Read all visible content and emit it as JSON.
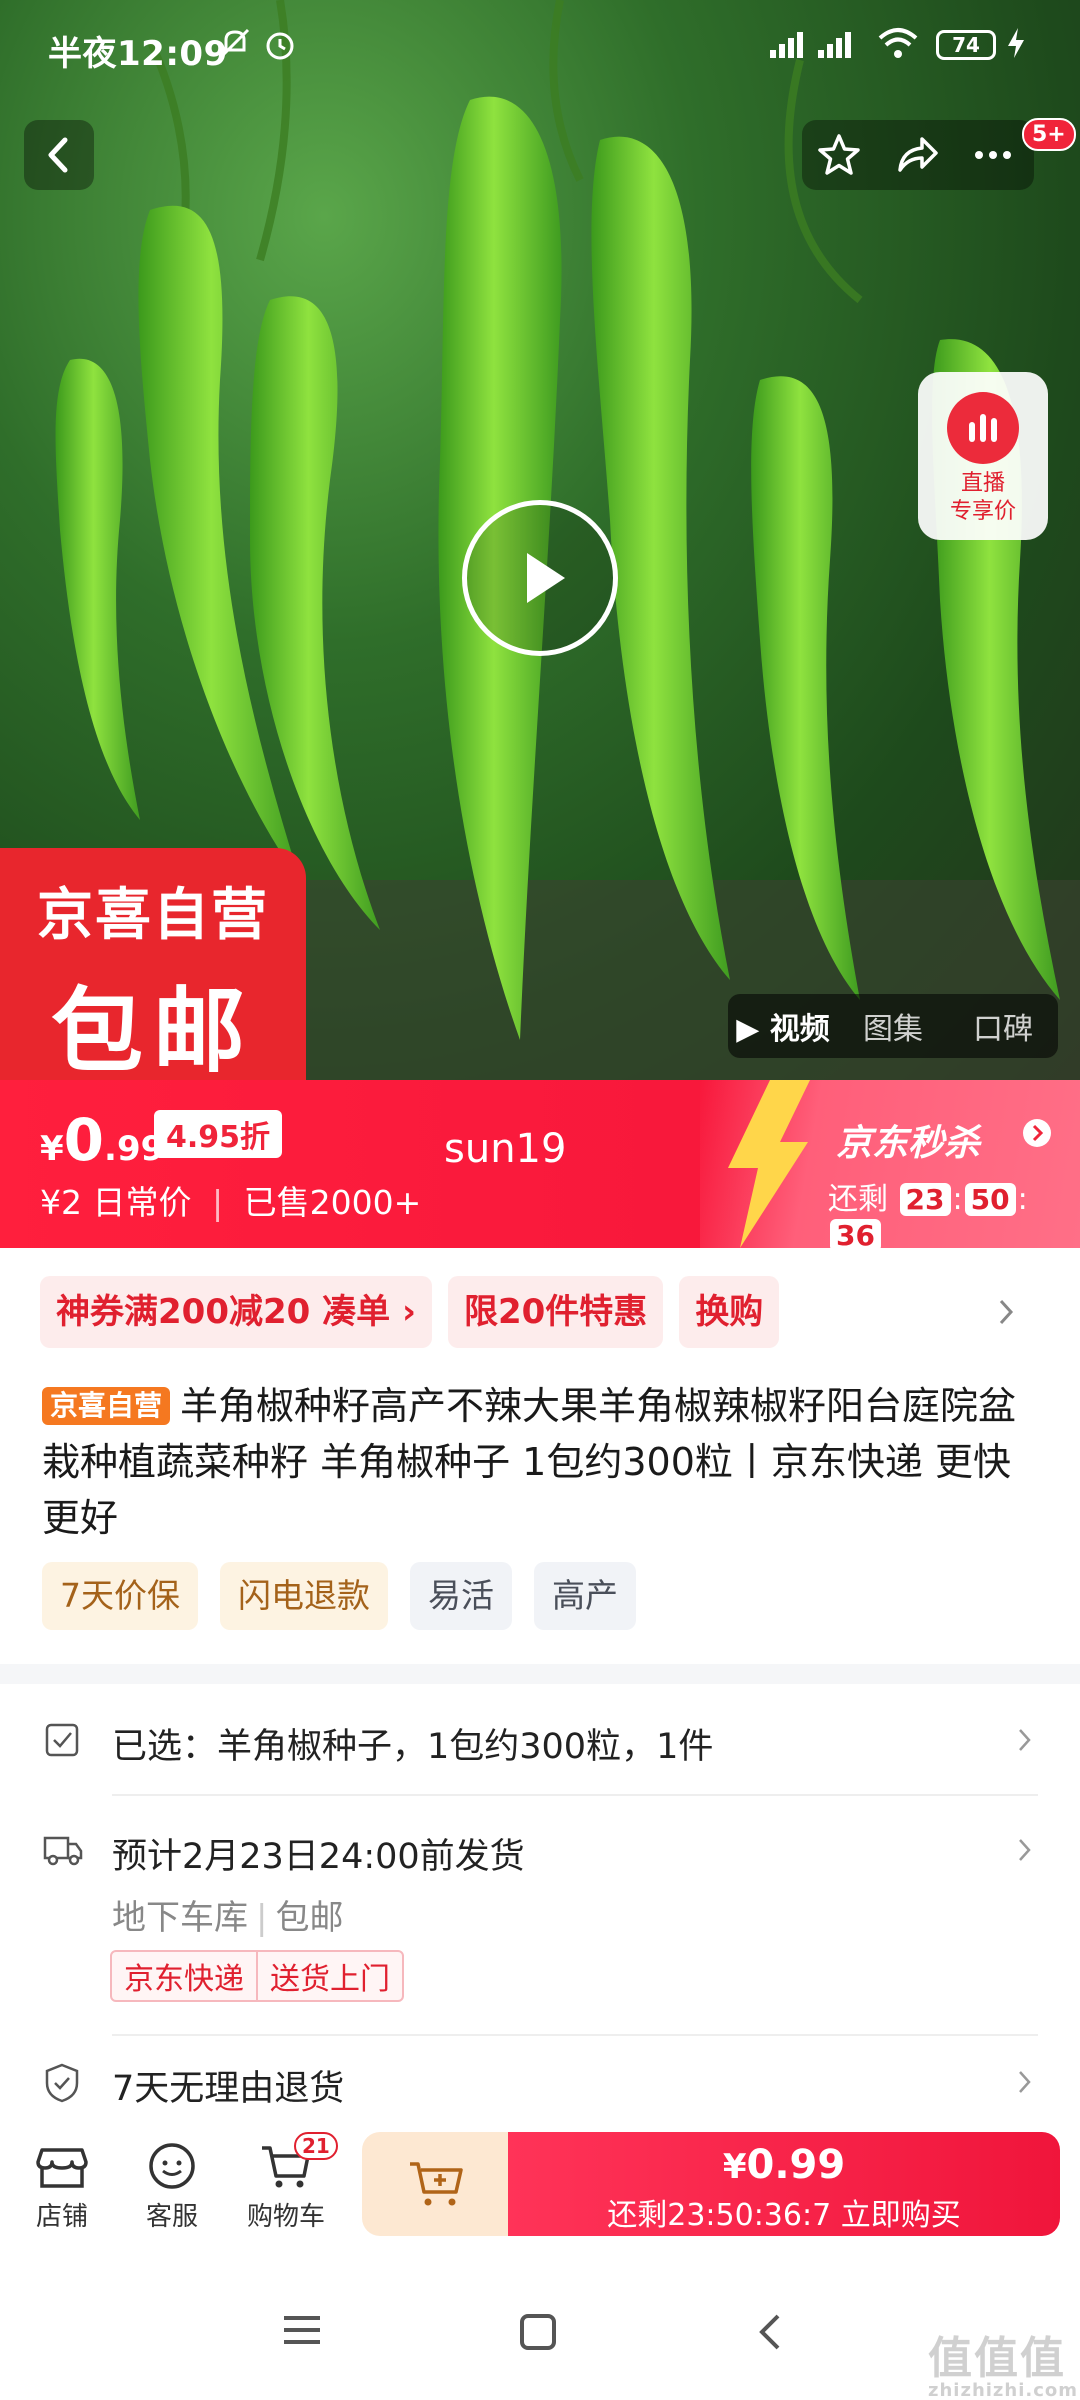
{
  "status_bar": {
    "time": "半夜12:09",
    "battery": "74"
  },
  "header": {
    "notification_badge": "5+"
  },
  "live": {
    "label_line1": "直播",
    "label_line2": "专享价"
  },
  "brand_tag": {
    "line1": "京喜自营",
    "line2": "包邮"
  },
  "media_tabs": [
    "视频",
    "图集",
    "口碑"
  ],
  "price": {
    "currency": "¥",
    "integer": "0",
    "decimal": ".99",
    "discount": "4.95折",
    "original": "¥2",
    "original_label": "日常价",
    "sold": "已售2000+",
    "center_text": "sun19"
  },
  "seckill": {
    "title": "京东秒杀",
    "remain_label": "还剩",
    "hours": "23",
    "minutes": "50",
    "seconds": "36"
  },
  "promos": [
    {
      "label": "神券满200减20  凑单"
    },
    {
      "label": "限20件特惠"
    },
    {
      "label": "换购"
    }
  ],
  "product": {
    "own_badge": "京喜自营",
    "title": "羊角椒种籽高产不辣大果羊角椒辣椒籽阳台庭院盆栽种植蔬菜种籽 羊角椒种子 1包约300粒丨京东快递 更快更好",
    "tags": [
      "7天价保",
      "闪电退款",
      "易活",
      "高产"
    ]
  },
  "selection": {
    "text": "已选：羊角椒种子，1包约300粒，1件"
  },
  "shipping": {
    "text": "预计2月23日24:00前发货",
    "from": "地下车库",
    "fee": "包邮",
    "tag1": "京东快递",
    "tag2": "送货上门"
  },
  "returns": {
    "text": "7天无理由退货"
  },
  "bottom_bar": {
    "shop": "店铺",
    "service": "客服",
    "cart": "购物车",
    "cart_count": "21",
    "buy_price_symbol": "¥",
    "buy_price": "0.99",
    "buy_countdown": "还剩23:50:36:7",
    "buy_label": "立即购买"
  },
  "watermark": {
    "main": "值值值",
    "sub": "zhizhizhi.com"
  },
  "colors": {
    "accent_red": "#f0243a",
    "orange_badge": "#f57820",
    "brand_red": "#e8262d"
  }
}
